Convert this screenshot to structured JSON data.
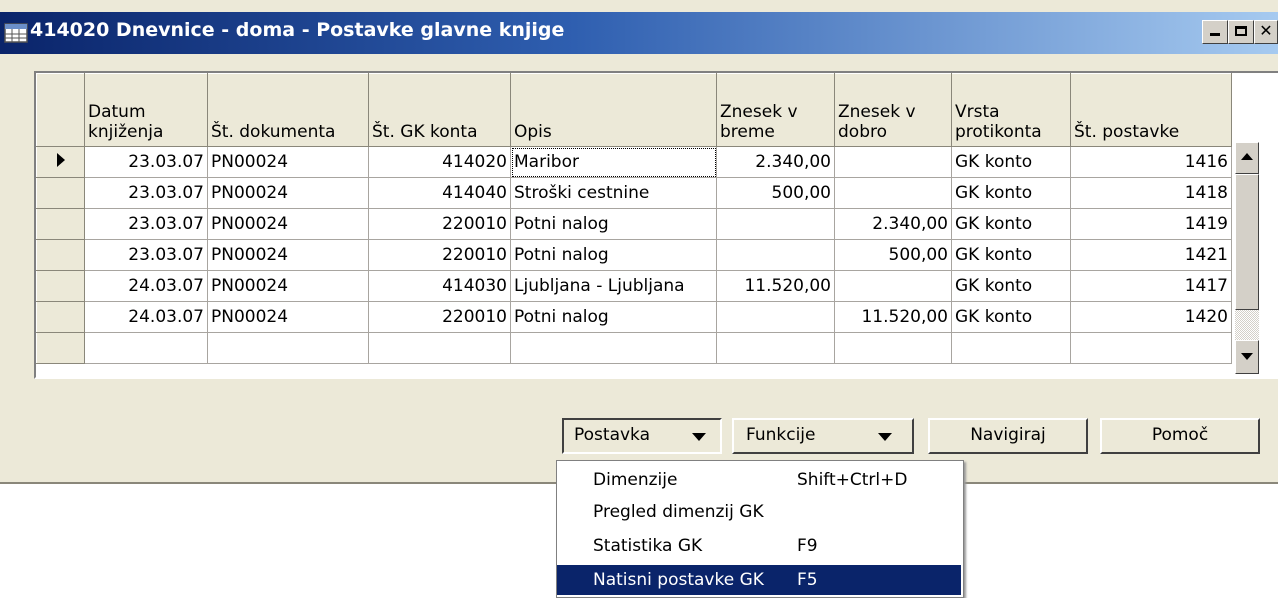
{
  "window": {
    "title": "414020 Dnevnice - doma - Postavke glavne knjige"
  },
  "columns": [
    "Datum knjiženja",
    "Št. dokumenta",
    "Št. GK konta",
    "Opis",
    "Znesek v breme",
    "Znesek v dobro",
    "Vrsta protikonta",
    "Št. postavke"
  ],
  "rows": [
    {
      "date": "23.03.07",
      "doc": "PN00024",
      "account": "414020",
      "desc": "Maribor",
      "debit": "2.340,00",
      "credit": "",
      "type": "GK konto",
      "entry": "1416"
    },
    {
      "date": "23.03.07",
      "doc": "PN00024",
      "account": "414040",
      "desc": "Stroški cestnine",
      "debit": "500,00",
      "credit": "",
      "type": "GK konto",
      "entry": "1418"
    },
    {
      "date": "23.03.07",
      "doc": "PN00024",
      "account": "220010",
      "desc": "Potni nalog",
      "debit": "",
      "credit": "2.340,00",
      "type": "GK konto",
      "entry": "1419"
    },
    {
      "date": "23.03.07",
      "doc": "PN00024",
      "account": "220010",
      "desc": "Potni nalog",
      "debit": "",
      "credit": "500,00",
      "type": "GK konto",
      "entry": "1421"
    },
    {
      "date": "24.03.07",
      "doc": "PN00024",
      "account": "414030",
      "desc": "Ljubljana - Ljubljana",
      "debit": "11.520,00",
      "credit": "",
      "type": "GK konto",
      "entry": "1417"
    },
    {
      "date": "24.03.07",
      "doc": "PN00024",
      "account": "220010",
      "desc": "Potni nalog",
      "debit": "",
      "credit": "11.520,00",
      "type": "GK konto",
      "entry": "1420"
    }
  ],
  "buttons": {
    "postavka": "Postavka",
    "funkcije": "Funkcije",
    "navigiraj": "Navigiraj",
    "pomoc": "Pomoč"
  },
  "menu": [
    {
      "label": "Dimenzije",
      "shortcut": "Shift+Ctrl+D"
    },
    {
      "label": "Pregled dimenzij GK",
      "shortcut": ""
    },
    {
      "label": "Statistika GK",
      "shortcut": "F9"
    },
    {
      "label": "Natisni postavke GK",
      "shortcut": "F5"
    }
  ],
  "colors": {
    "title_start": "#0a246a",
    "title_end": "#a6caf0",
    "menu_highlight": "#0a246a",
    "face": "#ece9d8"
  }
}
